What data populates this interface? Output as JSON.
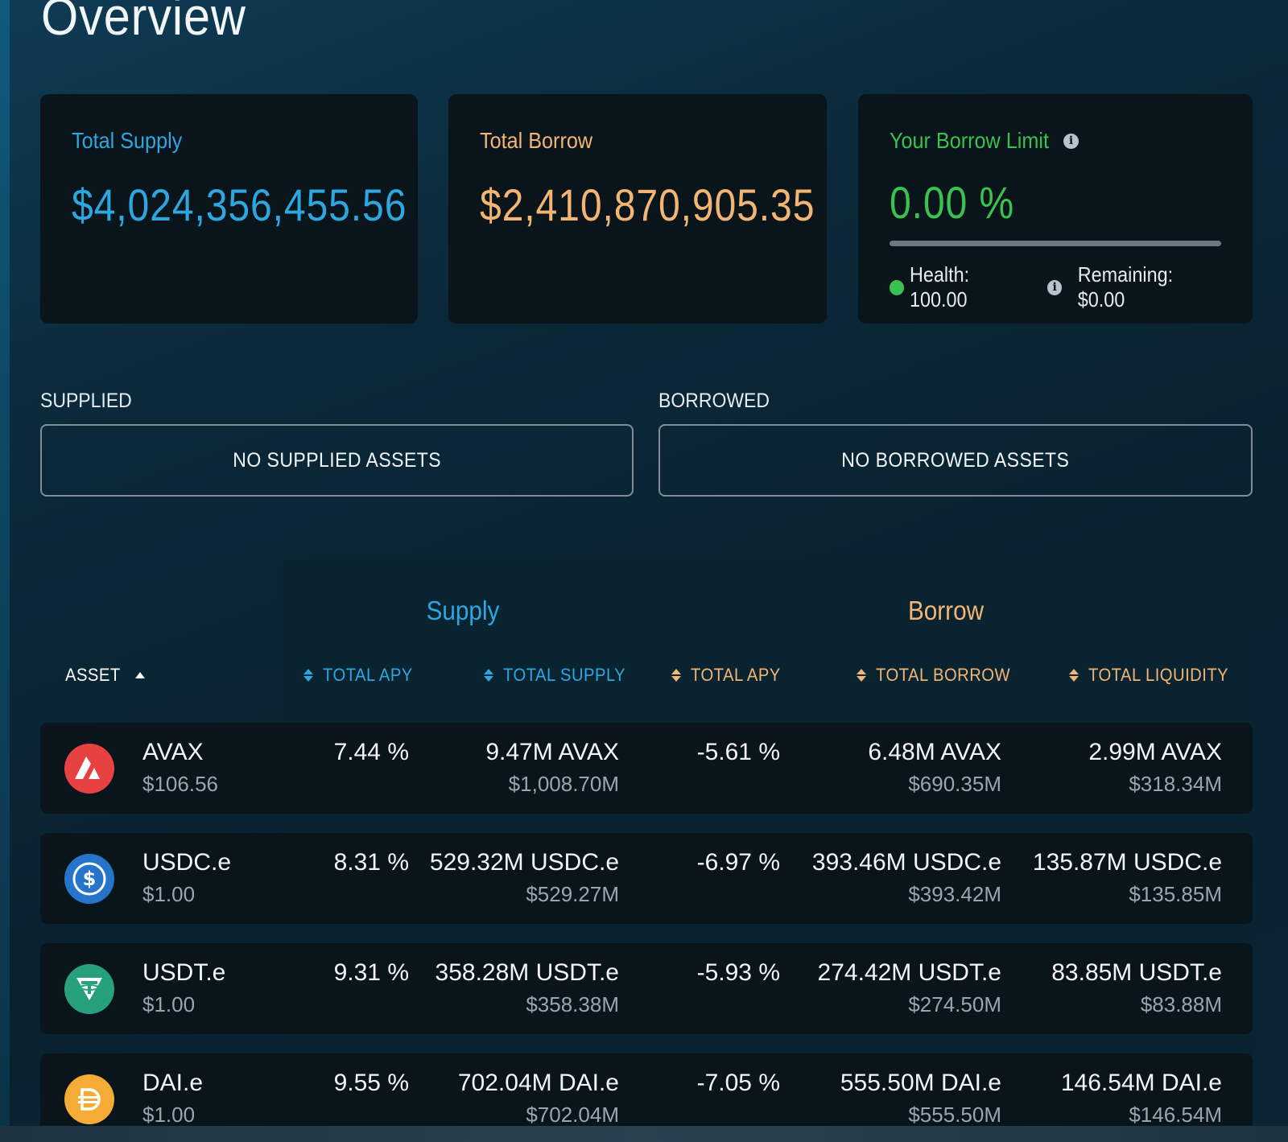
{
  "page": {
    "title": "Overview"
  },
  "cards": {
    "total_supply": {
      "label": "Total Supply",
      "value": "$4,024,356,455.56"
    },
    "total_borrow": {
      "label": "Total Borrow",
      "value": "$2,410,870,905.35"
    },
    "borrow_limit": {
      "label": "Your Borrow Limit",
      "value": "0.00 %",
      "fill_fraction": 0,
      "health_label": "Health:",
      "health_value": "100.00",
      "remaining_label": "Remaining:",
      "remaining_value": "$0.00"
    }
  },
  "supplied": {
    "label": "SUPPLIED",
    "empty_text": "NO SUPPLIED ASSETS"
  },
  "borrowed": {
    "label": "BORROWED",
    "empty_text": "NO BORROWED ASSETS"
  },
  "table": {
    "group_supply": "Supply",
    "group_borrow": "Borrow",
    "headers": {
      "asset": "ASSET",
      "supply_apy": "TOTAL APY",
      "total_supply": "TOTAL SUPPLY",
      "borrow_apy": "TOTAL APY",
      "total_borrow": "TOTAL BORROW",
      "total_liquidity": "TOTAL LIQUIDITY"
    },
    "rows": [
      {
        "asset": "AVAX",
        "icon": "avax-icon",
        "price": "$106.56",
        "supply_apy": "7.44 %",
        "supply_amount": "9.47M AVAX",
        "supply_usd": "$1,008.70M",
        "borrow_apy": "-5.61 %",
        "borrow_amount": "6.48M AVAX",
        "borrow_usd": "$690.35M",
        "liquidity_amount": "2.99M AVAX",
        "liquidity_usd": "$318.34M"
      },
      {
        "asset": "USDC.e",
        "icon": "usdc-icon",
        "price": "$1.00",
        "supply_apy": "8.31 %",
        "supply_amount": "529.32M USDC.e",
        "supply_usd": "$529.27M",
        "borrow_apy": "-6.97 %",
        "borrow_amount": "393.46M USDC.e",
        "borrow_usd": "$393.42M",
        "liquidity_amount": "135.87M USDC.e",
        "liquidity_usd": "$135.85M"
      },
      {
        "asset": "USDT.e",
        "icon": "usdt-icon",
        "price": "$1.00",
        "supply_apy": "9.31 %",
        "supply_amount": "358.28M USDT.e",
        "supply_usd": "$358.38M",
        "borrow_apy": "-5.93 %",
        "borrow_amount": "274.42M USDT.e",
        "borrow_usd": "$274.50M",
        "liquidity_amount": "83.85M USDT.e",
        "liquidity_usd": "$83.88M"
      },
      {
        "asset": "DAI.e",
        "icon": "dai-icon",
        "price": "$1.00",
        "supply_apy": "9.55 %",
        "supply_amount": "702.04M DAI.e",
        "supply_usd": "$702.04M",
        "borrow_apy": "-7.05 %",
        "borrow_amount": "555.50M DAI.e",
        "borrow_usd": "$555.50M",
        "liquidity_amount": "146.54M DAI.e",
        "liquidity_usd": "$146.54M"
      }
    ]
  },
  "colors": {
    "supply": "#2ea7e0",
    "borrow": "#f2b574",
    "limit": "#39c24f",
    "card_bg": "#0a141b"
  }
}
